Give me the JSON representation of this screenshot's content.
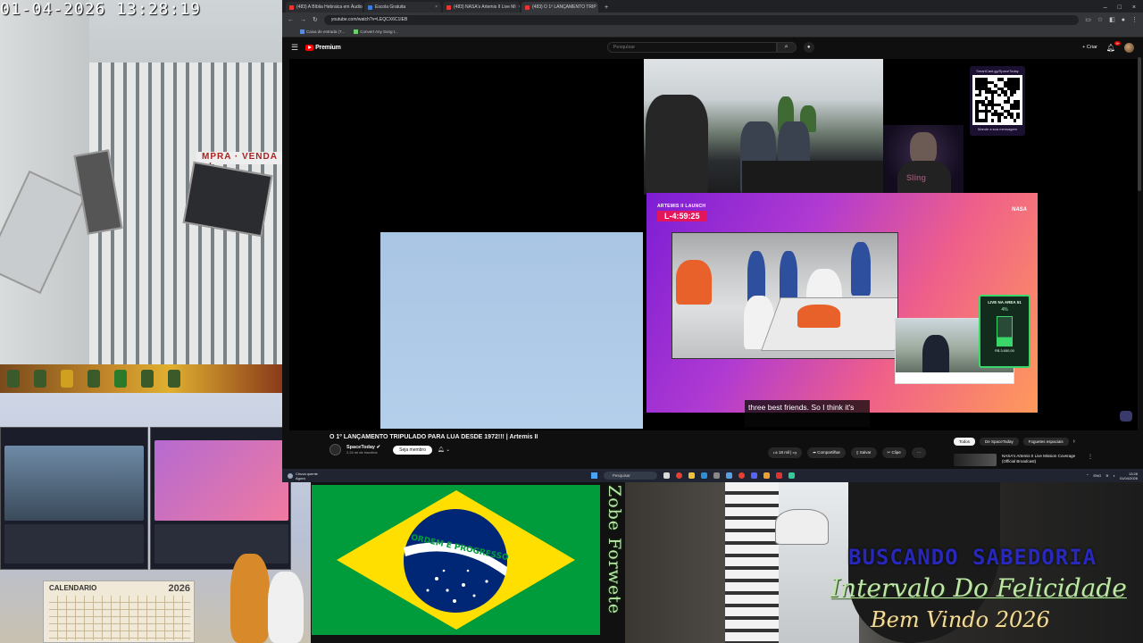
{
  "camera_left": {
    "timestamp": "01-04-2026 13:28:19",
    "sign_text": "MPRA · VENDA · L"
  },
  "calendar": {
    "title": "CALENDARIO",
    "year": "2026"
  },
  "browser": {
    "tabs": [
      {
        "label": "(483) A Bíblia Hebraica em Áudio",
        "active": false
      },
      {
        "label": "Escola Gratuita",
        "active": false
      },
      {
        "label": "(483) NASA's Artemis II Live Mi",
        "active": false
      },
      {
        "label": "(483) O 1º LANÇAMENTO TRIP",
        "active": true
      }
    ],
    "new_tab": "+",
    "url": "youtube.com/watch?v=LEQCX6C1IEB",
    "bookmarks": [
      "Caixa de entrada (7...",
      "Convert Any Song t..."
    ]
  },
  "youtube": {
    "logo": "Premium",
    "search_placeholder": "Pesquisar",
    "create_label": "Criar",
    "notification_count": "9+",
    "video_title": "O 1º LANÇAMENTO TRIPULADO PARA LUA DESDE 1972!!! | Artemis II",
    "channel_name": "SpaceToday",
    "channel_subs": "2,24 mi de inscritos",
    "join_label": "Seja membro",
    "actions": [
      "18 mil",
      "Compartilhar",
      "Salvar",
      "Clipe",
      "···"
    ],
    "chips": [
      {
        "label": "Todos",
        "active": true
      },
      {
        "label": "De SpaceToday",
        "active": false
      },
      {
        "label": "Foguetes espaciais",
        "active": false
      }
    ],
    "related_title": "NASA's Artemis II Live Mission Coverage (Official Broadcast)"
  },
  "player": {
    "qr_url": "SmartCast.gg/SpaceToday",
    "qr_message": "Mande a sua mensagem",
    "nasa_label": "ARTEMIS II LAUNCH",
    "countdown": "L-4:59:25",
    "nasa_logo": "NASA",
    "live51_title": "LIVE NA AREA 51",
    "live51_percent": "4%",
    "live51_amount": "R$ 3.650,00",
    "gamer_shirt": "Sling",
    "caption": "three best friends. So I think it's"
  },
  "taskbar": {
    "weather_title": "Chuva quente",
    "weather_sub": "Agora",
    "search_label": "Pesquisar",
    "lang": "ENG",
    "time": "13:28",
    "date": "01/04/2026"
  },
  "flag": {
    "motto": "ORDEM E PROGRESSO"
  },
  "overlays": {
    "vertical": "Zobe Forwete",
    "line1": "BUSCANDO SABEDORIA",
    "line2": "Intervalo Do Felicidade",
    "line3": "Bem Vindo 2026"
  },
  "colors": {
    "youtube_red": "#ff0000",
    "flag_green": "#009b3a",
    "flag_yellow": "#fedf00",
    "flag_blue": "#002776",
    "nasa_pink": "#e5155c"
  }
}
